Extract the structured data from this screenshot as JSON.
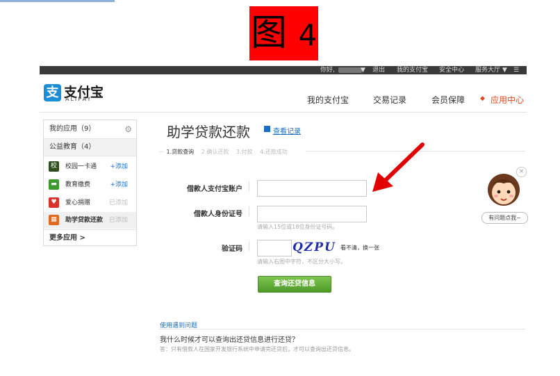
{
  "figure_label": {
    "char": "图",
    "num": "4"
  },
  "topbar": {
    "greeting": "你好,",
    "logout": "退出",
    "my_alipay": "我的支付宝",
    "security": "安全中心",
    "service": "服务大厅 ▼"
  },
  "logo": {
    "mark": "支",
    "cn": "支付宝",
    "en": "ALIPAY"
  },
  "nav": {
    "my_alipay": "我的支付宝",
    "transactions": "交易记录",
    "membership": "会员保障",
    "app_center": "应用中心"
  },
  "sidebar": {
    "my_apps": "我的应用（9）",
    "public_edu": "公益教育（4）",
    "items": [
      {
        "label": "校园一卡通",
        "action": "+添加",
        "icon": "校",
        "color": "#2f4f1f"
      },
      {
        "label": "教育缴费",
        "action": "+添加",
        "icon": "▬",
        "color": "#3f9a2d"
      },
      {
        "label": "爱心捐赠",
        "action": "已添加",
        "icon": "♥",
        "color": "#d8322a"
      },
      {
        "label": "助学贷款还款",
        "action": "已添加",
        "icon": "▦",
        "color": "#e06b1e"
      }
    ],
    "more": "更多应用 >"
  },
  "main": {
    "title": "助学贷款还款",
    "record_link": "查看记录",
    "steps": [
      "1.贷款查询",
      "2.确认还款",
      "3.付款",
      "4.还款成功"
    ],
    "account_label": "借款人支付宝账户",
    "account_value": "",
    "id_label": "借款人身份证号",
    "id_value": "",
    "id_hint": "请输入15位或18位身份证号码。",
    "captcha_label": "验证码",
    "captcha_value": "",
    "captcha_text": "QZPU",
    "captcha_refresh": "看不清，换一张",
    "captcha_hint": "请输入右图中字符，不区分大小写。",
    "submit": "查询还贷信息"
  },
  "faq": {
    "title": "使用遇到问题",
    "question": "我什么时候才可以查询出还贷信息进行还贷？",
    "answer": "答：只有借款人在国家开发银行系统中申请完还贷后，才可以查询出还贷信息。"
  },
  "helper": {
    "tag": "有问题点我~",
    "close": "×"
  },
  "colors": {
    "accent_orange": "#e0491f",
    "link_blue": "#1a6fc4",
    "arrow_red": "#e00000",
    "button_green": "#5aa82f"
  }
}
